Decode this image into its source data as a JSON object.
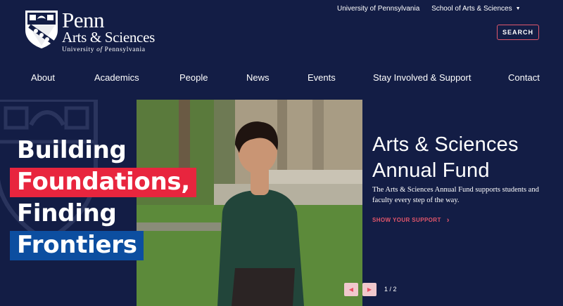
{
  "logo": {
    "line1": "Penn",
    "line2": "Arts & Sciences",
    "line3_a": "University",
    "line3_of": "of",
    "line3_b": "Pennsylvania"
  },
  "top_links": [
    {
      "label": "University of Pennsylvania"
    },
    {
      "label": "School of Arts & Sciences"
    }
  ],
  "search": {
    "label": "SEARCH"
  },
  "nav": [
    {
      "label": "About"
    },
    {
      "label": "Academics"
    },
    {
      "label": "People"
    },
    {
      "label": "News"
    },
    {
      "label": "Events"
    },
    {
      "label": "Stay Involved & Support"
    },
    {
      "label": "Contact"
    }
  ],
  "hero": {
    "headline": [
      "Building",
      "Foundations,",
      "Finding",
      "Frontiers"
    ],
    "title_line1": "Arts & Sciences",
    "title_line2": "Annual Fund",
    "description": "The Arts & Sciences Annual Fund supports students and faculty every step of the way.",
    "cta": "SHOW YOUR SUPPORT",
    "slide_counter": "1 / 2"
  },
  "colors": {
    "background": "#131d45",
    "accent_red": "#e8253e",
    "accent_blue": "#0c4ea0",
    "link_pink": "#e4566b"
  },
  "icons": [
    "penn-shield-icon",
    "caret-down-icon",
    "chevron-right-icon",
    "prev-arrow-icon",
    "next-arrow-icon"
  ]
}
